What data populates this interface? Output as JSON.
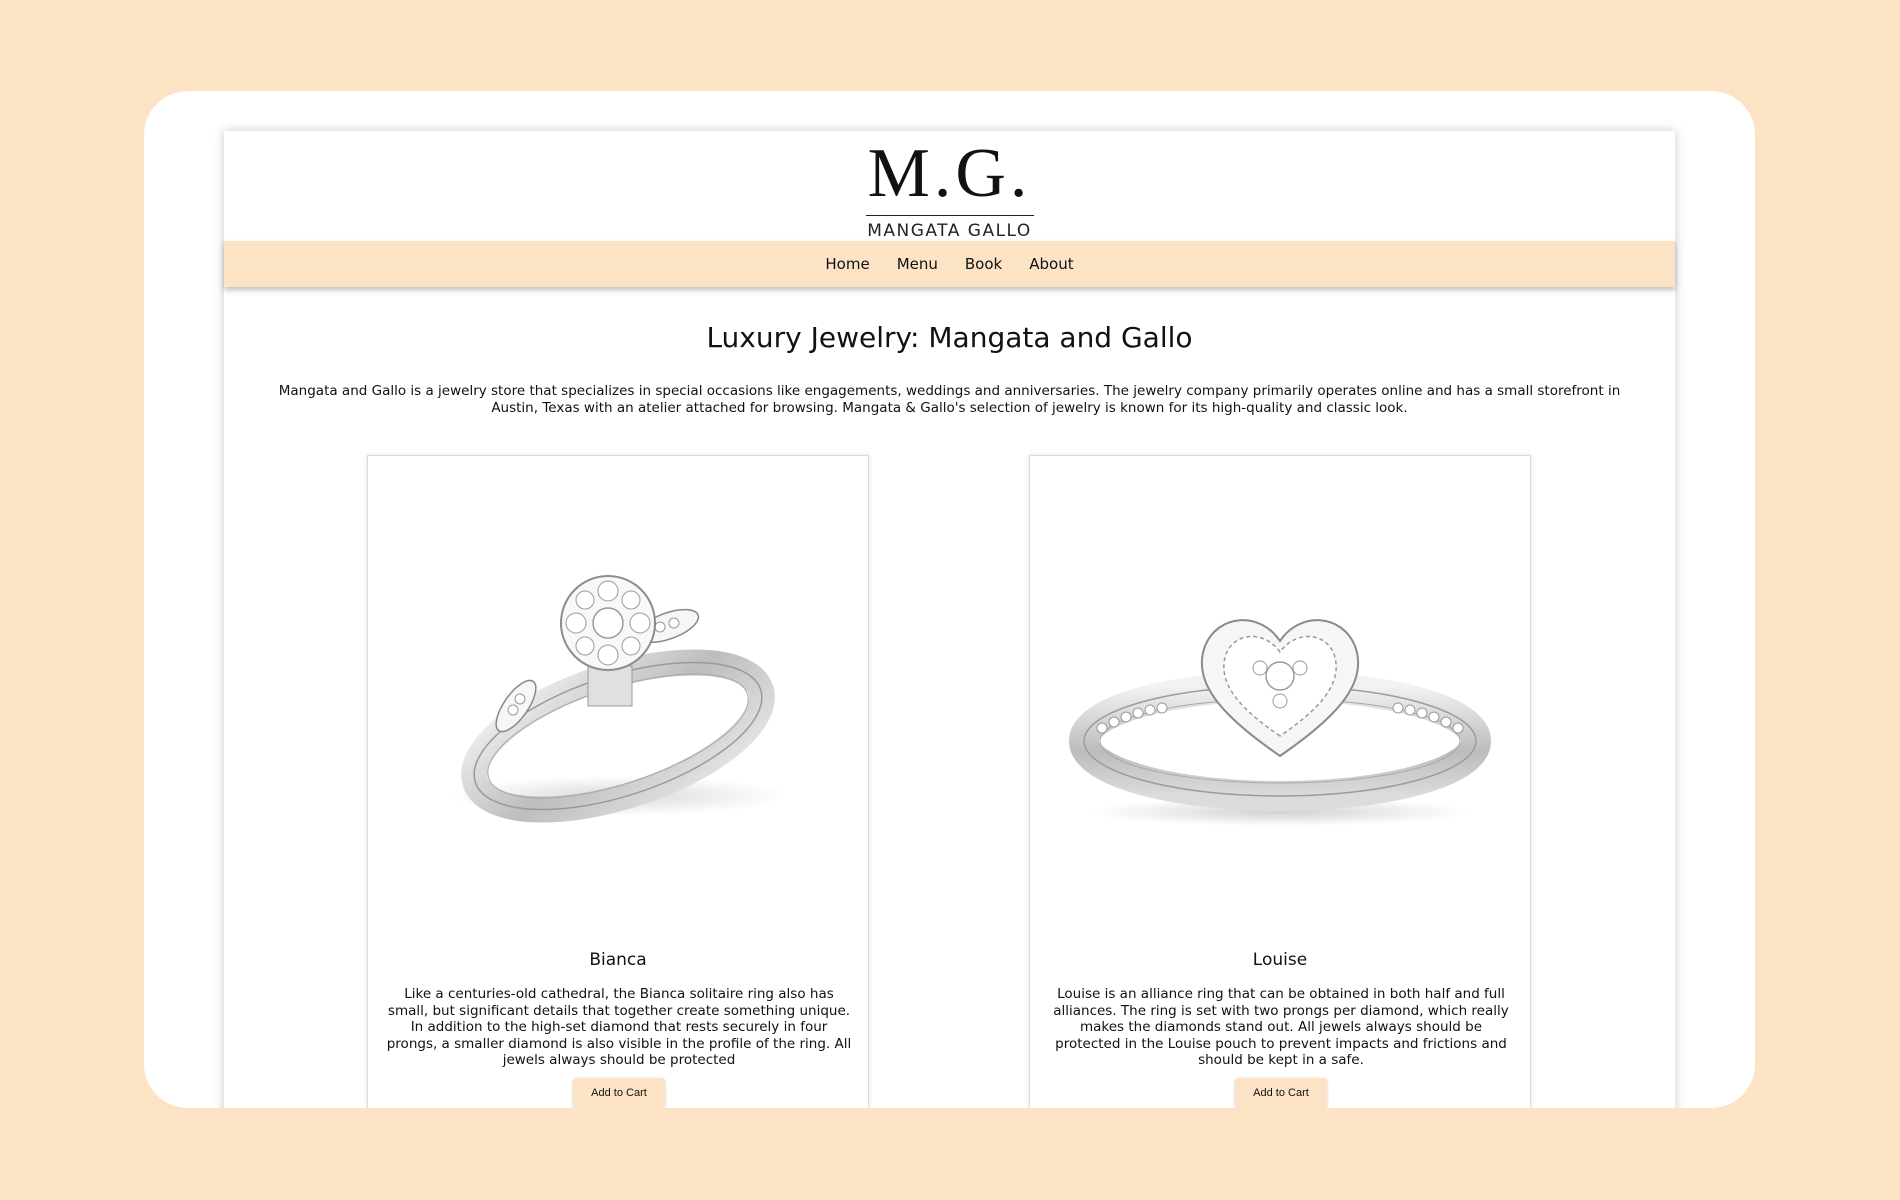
{
  "logo": {
    "mark": "M.G.",
    "subtitle": "MANGATA GALLO"
  },
  "nav": {
    "items": [
      {
        "label": "Home"
      },
      {
        "label": "Menu"
      },
      {
        "label": "Book"
      },
      {
        "label": "About"
      }
    ]
  },
  "main": {
    "title": "Luxury Jewelry: Mangata and Gallo",
    "intro": "Mangata and Gallo is a jewelry store that specializes in special occasions like engagements, weddings and anniversaries. The jewelry company primarily operates online and has a small storefront in Austin, Texas with an atelier attached for browsing. Mangata & Gallo's selection of jewelry is known for its high-quality and classic look."
  },
  "products": [
    {
      "name": "Bianca",
      "description": "Like a centuries-old cathedral, the Bianca solitaire ring also has small, but significant details that together create something unique. In addition to the high-set diamond that rests securely in four prongs, a smaller diamond is also visible in the profile of the ring. All jewels always should be protected",
      "button_label": "Add to Cart",
      "image_icon": "solitaire-ring-icon"
    },
    {
      "name": "Louise",
      "description": "Louise is an alliance ring that can be obtained in both half and full alliances. The ring is set with two prongs per diamond, which really makes the diamonds stand out. All jewels always should be protected in the Louise pouch to prevent impacts and frictions and should be kept in a safe.",
      "button_label": "Add to Cart",
      "image_icon": "heart-ring-icon"
    }
  ],
  "colors": {
    "accent": "#fde3c6",
    "text": "#111111"
  }
}
